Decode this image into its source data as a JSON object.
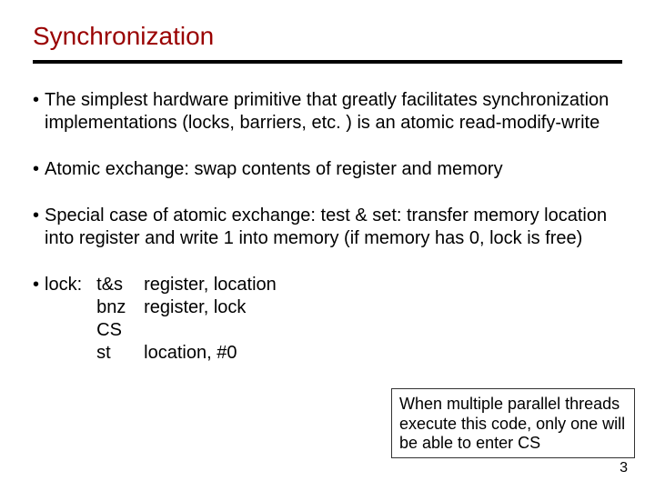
{
  "title": "Synchronization",
  "bullets": {
    "b1": "The simplest hardware primitive that greatly facilitates synchronization implementations (locks, barriers, etc. ) is an atomic read-modify-write",
    "b2": "Atomic exchange: swap contents of register and memory",
    "b3": "Special case of atomic exchange: test & set: transfer memory location into register and write 1 into memory (if memory has 0, lock is free)",
    "b4_label": "lock:",
    "code": {
      "ops": "t&s\nbnz\nCS\nst",
      "args": "register, location\nregister, lock\n\nlocation, #0"
    }
  },
  "note": "When multiple parallel threads execute this code, only one will be able to enter CS",
  "page": "3"
}
